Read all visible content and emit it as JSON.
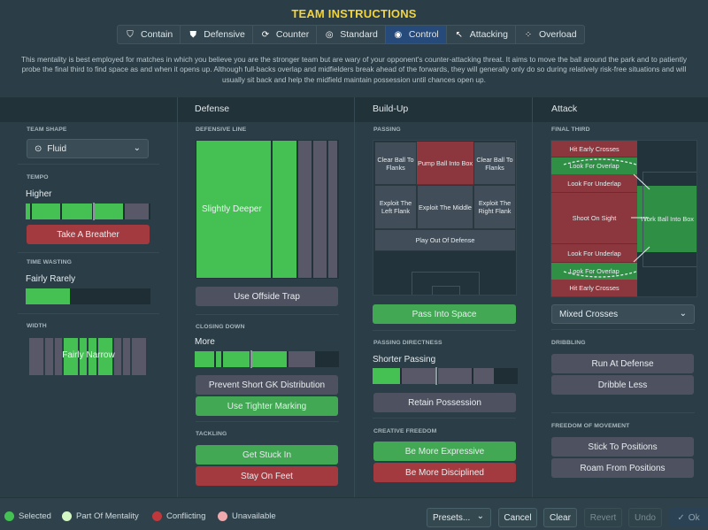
{
  "title": "TEAM INSTRUCTIONS",
  "mentalities": [
    {
      "label": "Contain",
      "icon": "contain-shield-icon",
      "active": false
    },
    {
      "label": "Defensive",
      "icon": "defensive-shield-icon",
      "active": false
    },
    {
      "label": "Counter",
      "icon": "counter-icon",
      "active": false
    },
    {
      "label": "Standard",
      "icon": "standard-icon",
      "active": false
    },
    {
      "label": "Control",
      "icon": "control-icon",
      "active": true
    },
    {
      "label": "Attacking",
      "icon": "attacking-arrow-icon",
      "active": false
    },
    {
      "label": "Overload",
      "icon": "overload-icon",
      "active": false
    }
  ],
  "description": "This mentality is best employed for matches in which you believe you are the stronger team but are wary of your opponent's counter-attacking threat. It aims to move the ball around the park and to patiently probe the final third to find space as and when it opens up. Although full-backs overlap and midfielders break ahead of the forwards, they will generally only do so during relatively risk-free situations and will usually sit back and help the midfield maintain possession until chances open up.",
  "general": {
    "team_shape": {
      "label": "TEAM SHAPE",
      "value": "Fluid"
    },
    "tempo": {
      "label": "TEMPO",
      "value": "Higher",
      "level": 4,
      "max": 5,
      "button": "Take A Breather"
    },
    "time_wasting": {
      "label": "TIME WASTING",
      "value": "Fairly Rarely",
      "level": 2,
      "max": 10
    },
    "width": {
      "label": "WIDTH",
      "value": "Fairly Narrow"
    }
  },
  "defense": {
    "title": "Defense",
    "defensive_line": {
      "label": "DEFENSIVE LINE",
      "value": "Slightly Deeper"
    },
    "offside_button": "Use Offside Trap",
    "closing_down": {
      "label": "CLOSING DOWN",
      "value": "More",
      "level": 4,
      "max": 6
    },
    "buttons": [
      "Prevent Short GK Distribution",
      "Use Tighter Marking"
    ],
    "tackling": {
      "label": "TACKLING",
      "buttons": [
        "Get Stuck In",
        "Stay On Feet"
      ]
    }
  },
  "buildup": {
    "title": "Build-Up",
    "passing": {
      "label": "PASSING",
      "zones": {
        "clear_left": "Clear Ball To Flanks",
        "pump": "Pump Ball Into Box",
        "clear_right": "Clear Ball To Flanks",
        "exploit_left": "Exploit The Left Flank",
        "exploit_middle": "Exploit The Middle",
        "exploit_right": "Exploit The Right Flank",
        "play_out": "Play Out Of Defense"
      }
    },
    "pass_into_space": "Pass Into Space",
    "directness": {
      "label": "PASSING DIRECTNESS",
      "value": "Shorter Passing",
      "level": 1,
      "max": 5,
      "button": "Retain Possession"
    },
    "creative": {
      "label": "CREATIVE FREEDOM",
      "buttons": [
        "Be More Expressive",
        "Be More Disciplined"
      ]
    }
  },
  "attack": {
    "title": "Attack",
    "final_third": {
      "label": "FINAL THIRD",
      "zones": {
        "hit_early_top": "Hit Early Crosses",
        "overlap_top": "Look For Overlap",
        "underlap_top": "Look For Underlap",
        "shoot": "Shoot On Sight",
        "underlap_bottom": "Look For Underlap",
        "overlap_bottom": "Look For Overlap",
        "hit_early_bottom": "Hit Early Crosses",
        "work_ball": "Work Ball Into Box"
      }
    },
    "crossing": "Mixed Crosses",
    "dribbling": {
      "label": "DRIBBLING",
      "buttons": [
        "Run At Defense",
        "Dribble Less"
      ]
    },
    "freedom": {
      "label": "FREEDOM OF MOVEMENT",
      "buttons": [
        "Stick To Positions",
        "Roam From Positions"
      ]
    }
  },
  "legend": [
    {
      "label": "Selected",
      "color": "#45c154"
    },
    {
      "label": "Part Of Mentality",
      "color": "#d4f7c4"
    },
    {
      "label": "Conflicting",
      "color": "#c0383c"
    },
    {
      "label": "Unavailable",
      "color": "#f0a9ac"
    }
  ],
  "footer_buttons": {
    "presets": "Presets...",
    "cancel": "Cancel",
    "clear": "Clear",
    "revert": "Revert",
    "undo": "Undo",
    "ok": "Ok"
  }
}
